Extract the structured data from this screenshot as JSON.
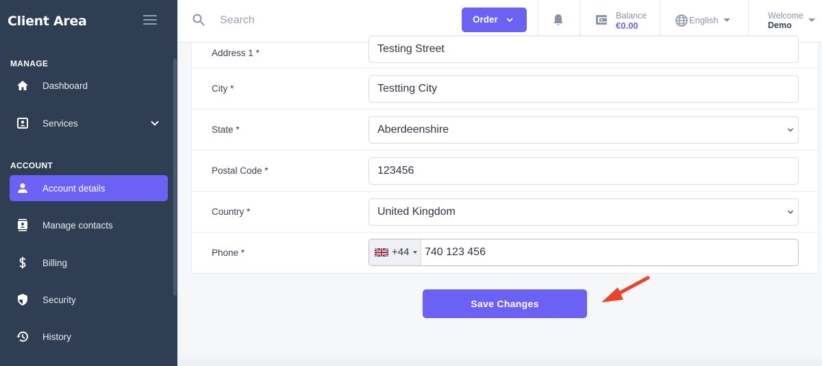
{
  "sidebar": {
    "brand": "Client Area",
    "sections": {
      "manage": "MANAGE",
      "account": "ACCOUNT"
    },
    "items": [
      {
        "label": "Dashboard",
        "icon": "home-icon"
      },
      {
        "label": "Services",
        "icon": "id-card-icon"
      },
      {
        "label": "Account details",
        "icon": "user-icon",
        "active": true
      },
      {
        "label": "Manage contacts",
        "icon": "contacts-icon"
      },
      {
        "label": "Billing",
        "icon": "dollar-icon"
      },
      {
        "label": "Security",
        "icon": "shield-icon"
      },
      {
        "label": "History",
        "icon": "history-icon"
      }
    ]
  },
  "header": {
    "search_placeholder": "Search",
    "order_label": "Order",
    "balance_label": "Balance",
    "balance_value": "€0.00",
    "language": "English",
    "welcome": "Welcome",
    "user": "Demo"
  },
  "form": {
    "address1": {
      "label": "Address 1 *",
      "value": "Testing Street"
    },
    "city": {
      "label": "City *",
      "value": "Testting City"
    },
    "state": {
      "label": "State *",
      "value": "Aberdeenshire"
    },
    "postal": {
      "label": "Postal Code *",
      "value": "123456"
    },
    "country": {
      "label": "Country *",
      "value": "United Kingdom"
    },
    "phone": {
      "label": "Phone *",
      "dial_code": "+44",
      "value": "740 123 456"
    },
    "save_label": "Save Changes"
  },
  "colors": {
    "accent": "#6b62f5",
    "sidebar": "#2f3e52",
    "annotation_arrow": "#f0412a"
  }
}
